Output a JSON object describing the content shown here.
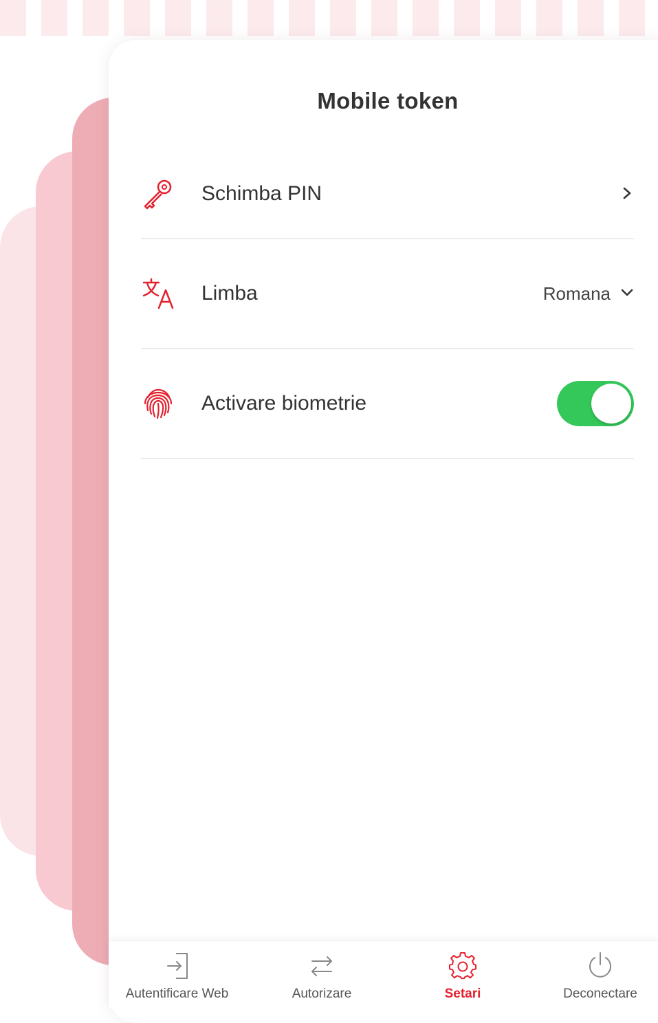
{
  "colors": {
    "accent": "#e5202e",
    "toggle_on": "#34c759",
    "text": "#333333"
  },
  "header": {
    "title": "Mobile token"
  },
  "settings": {
    "change_pin": {
      "label": "Schimba PIN",
      "icon": "key-icon"
    },
    "language": {
      "label": "Limba",
      "icon": "translate-icon",
      "selected_value": "Romana"
    },
    "biometrics": {
      "label": "Activare biometrie",
      "icon": "fingerprint-icon",
      "enabled": true
    }
  },
  "bottom_nav": {
    "items": [
      {
        "label": "Autentificare Web",
        "icon": "login-icon",
        "active": false
      },
      {
        "label": "Autorizare",
        "icon": "swap-arrows-icon",
        "active": false
      },
      {
        "label": "Setari",
        "icon": "gear-icon",
        "active": true
      },
      {
        "label": "Deconectare",
        "icon": "power-icon",
        "active": false
      }
    ]
  }
}
